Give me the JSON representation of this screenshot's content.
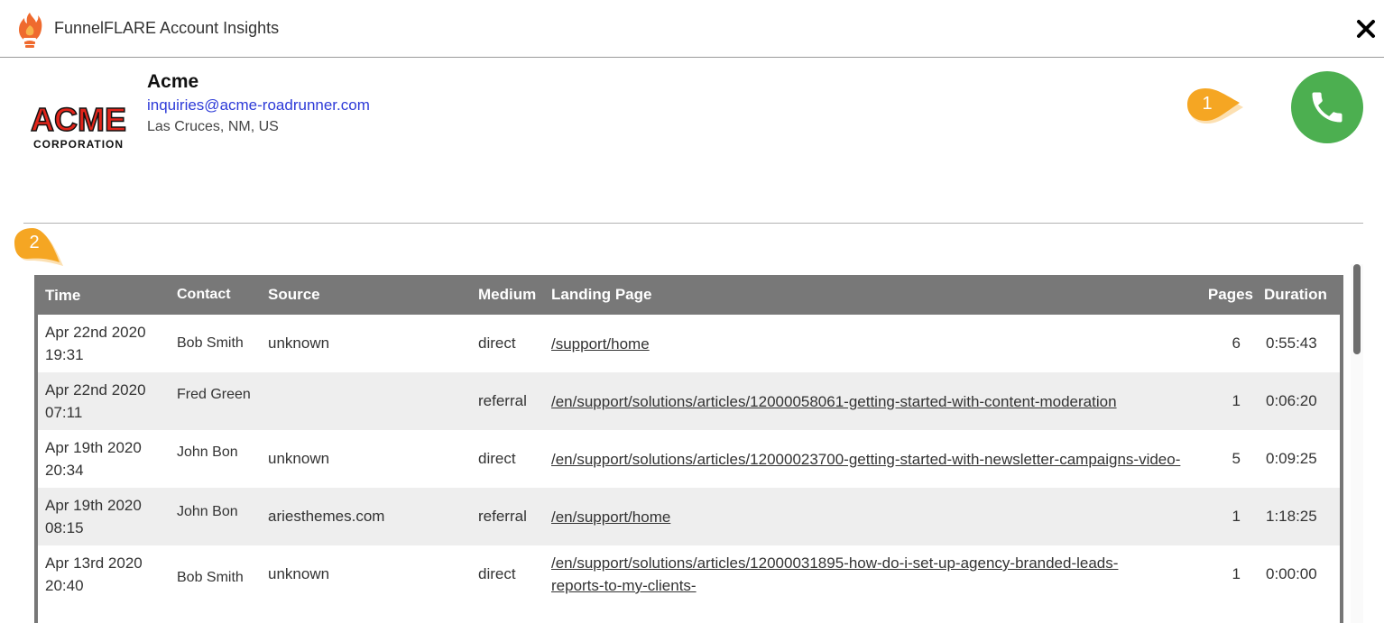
{
  "header": {
    "title": "FunnelFLARE Account Insights",
    "logo_icon": "flame-icon",
    "close_icon": "close-icon"
  },
  "account": {
    "logo_text_main": "ACME",
    "logo_text_sub": "CORPORATION",
    "name": "Acme",
    "email": "inquiries@acme-roadrunner.com",
    "location": "Las Cruces, NM, US",
    "call_icon": "phone-icon"
  },
  "markers": {
    "one": "1",
    "two": "2"
  },
  "colors": {
    "call_button": "#4caf50",
    "marker": "#f5a623",
    "table_header": "#787878",
    "email_link": "#2e3bd8"
  },
  "table": {
    "headers": {
      "time": "Time",
      "contact": "Contact",
      "source": "Source",
      "medium": "Medium",
      "landing": "Landing Page",
      "pages": "Pages",
      "duration": "Duration"
    },
    "rows": [
      {
        "date": "Apr 22nd 2020",
        "clock": "19:31",
        "contact": "Bob Smith",
        "source": "unknown",
        "medium": "direct",
        "landing": "/support/home",
        "pages": "6",
        "duration": "0:55:43"
      },
      {
        "date": "Apr 22nd 2020",
        "clock": "07:11",
        "contact": "Fred Green",
        "source": "",
        "medium": "referral",
        "landing": "/en/support/solutions/articles/12000058061-getting-started-with-content-moderation",
        "pages": "1",
        "duration": "0:06:20"
      },
      {
        "date": "Apr 19th 2020",
        "clock": "20:34",
        "contact": "John Bon",
        "source": "unknown",
        "medium": "direct",
        "landing": "/en/support/solutions/articles/12000023700-getting-started-with-newsletter-campaigns-video-",
        "pages": "5",
        "duration": "0:09:25"
      },
      {
        "date": "Apr 19th 2020",
        "clock": "08:15",
        "contact": "John Bon",
        "source": "ariesthemes.com",
        "medium": "referral",
        "landing": "/en/support/home",
        "pages": "1",
        "duration": "1:18:25"
      },
      {
        "date": "Apr 13rd 2020",
        "clock": "20:40",
        "contact": "Bob Smith",
        "source": "unknown",
        "medium": "direct",
        "landing": "/en/support/solutions/articles/12000031895-how-do-i-set-up-agency-branded-leads-reports-to-my-clients-",
        "pages": "1",
        "duration": "0:00:00"
      }
    ]
  }
}
